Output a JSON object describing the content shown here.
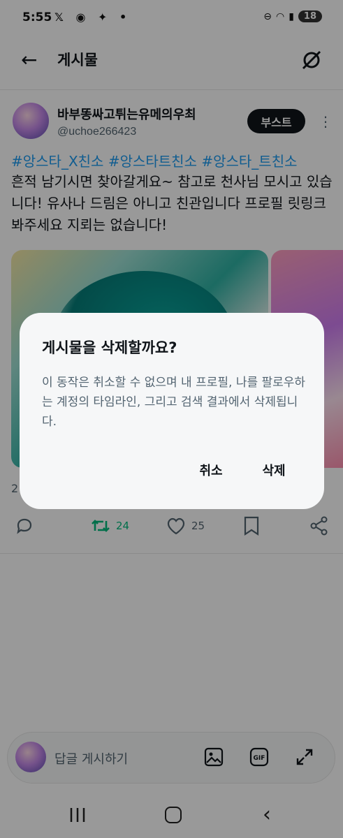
{
  "status_bar": {
    "time": "5:55",
    "left_icons": "𝕏 ◉ ✦ •",
    "battery": "18"
  },
  "header": {
    "title": "게시물",
    "back_icon": "arrow-left-icon",
    "grok_icon": "grok-icon"
  },
  "post": {
    "author_name": "바부똥싸고튀는유메의우최",
    "author_handle": "@uchoe266423",
    "boost_label": "부스트",
    "hashtags": "#앙스타_X친소 #앙스타트친소 #앙스타_트친소",
    "body": "흔적 남기시면 찾아갈게요~ 참고로 천사님 모시고 있습니다! 유사나 드림은 아니고 친관입니다 프로필 릿링크 봐주세요 지뢰는 없습니다!",
    "count_partial": "2",
    "actions": {
      "reply_icon": "reply-icon",
      "retweets": "24",
      "likes": "25",
      "bookmark_icon": "bookmark-icon",
      "share_icon": "share-icon"
    }
  },
  "reply_bar": {
    "placeholder": "답글 게시하기"
  },
  "dialog": {
    "title": "게시물을 삭제할까요?",
    "body": "이 동작은 취소할 수 없으며 내 프로필, 나를 팔로우하는 계정의 타임라인, 그리고 검색 결과에서 삭제됩니다.",
    "cancel_label": "취소",
    "delete_label": "삭제"
  },
  "colors": {
    "accent": "#1d9bf0",
    "retweet_green": "#00ba7c",
    "text": "#0f1419",
    "muted": "#536471"
  }
}
